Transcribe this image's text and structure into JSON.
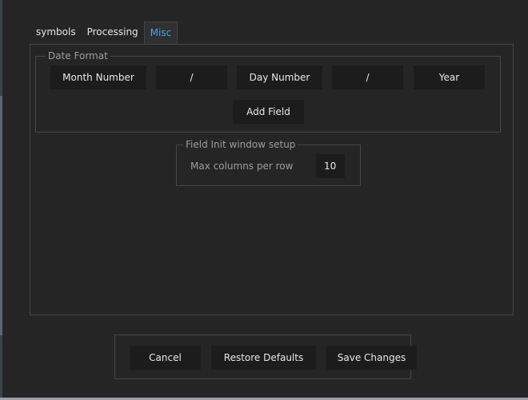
{
  "tabs": [
    {
      "label": "symbols"
    },
    {
      "label": "Processing"
    },
    {
      "label": "Misc"
    }
  ],
  "date_format": {
    "title": "Date Format",
    "fields": [
      {
        "label": "Month Number"
      },
      {
        "label": "/"
      },
      {
        "label": "Day Number"
      },
      {
        "label": "/"
      },
      {
        "label": "Year"
      }
    ],
    "add_field_label": "Add Field"
  },
  "field_init": {
    "title": "Field Init window setup",
    "max_columns_label": "Max columns per row",
    "max_columns_value": "10"
  },
  "buttons": {
    "cancel": "Cancel",
    "restore": "Restore Defaults",
    "save": "Save Changes"
  },
  "colors": {
    "active_tab": "#43a8ea",
    "background": "#252525",
    "field": "#1c1c1c"
  }
}
